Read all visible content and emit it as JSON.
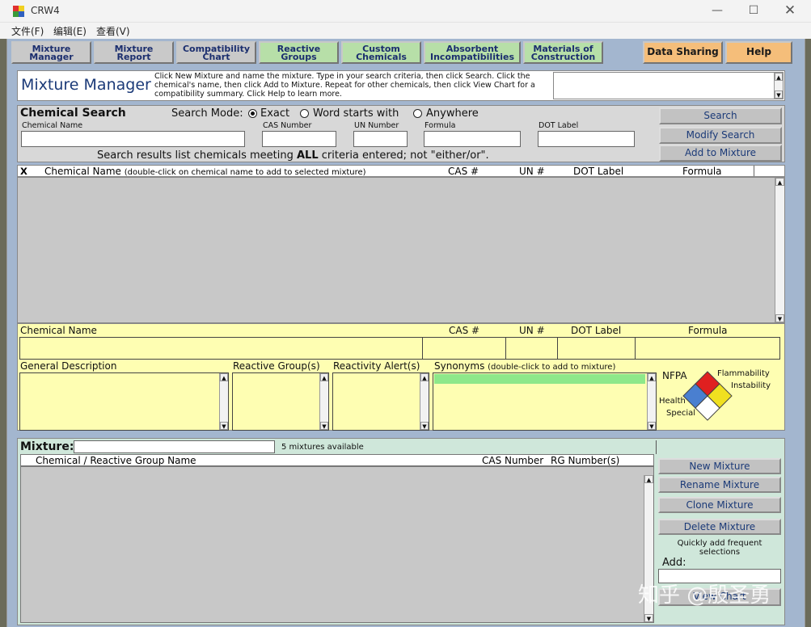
{
  "window": {
    "title": "CRW4"
  },
  "menu": [
    "文件(F)",
    "编辑(E)",
    "查看(V)"
  ],
  "tabs": [
    {
      "line1": "Mixture",
      "line2": "Manager"
    },
    {
      "line1": "Mixture",
      "line2": "Report"
    },
    {
      "line1": "Compatibility",
      "line2": "Chart"
    },
    {
      "line1": "Reactive",
      "line2": "Groups"
    },
    {
      "line1": "Custom",
      "line2": "Chemicals"
    },
    {
      "line1": "Absorbent",
      "line2": "Incompatibilities"
    },
    {
      "line1": "Materials of",
      "line2": "Construction"
    }
  ],
  "right_tabs": {
    "data_sharing": "Data Sharing",
    "help": "Help"
  },
  "header": {
    "title": "Mixture Manager",
    "instructions": "Click New Mixture and name the mixture. Type in your search criteria, then click Search. Click the chemical's name, then click Add to Mixture. Repeat for other chemicals, then click View Chart for a compatibility summary. Click Help to learn more."
  },
  "search": {
    "title": "Chemical Search",
    "mode_label": "Search Mode:",
    "modes": [
      "Exact",
      "Word starts with",
      "Anywhere"
    ],
    "selected_mode": "Exact",
    "field_labels": {
      "name": "Chemical Name",
      "cas": "CAS Number",
      "un": "UN Number",
      "formula": "Formula",
      "dot": "DOT Label"
    },
    "values": {
      "name": "",
      "cas": "",
      "un": "",
      "formula": "",
      "dot": ""
    },
    "note_before": "Search results list chemicals meeting ",
    "note_bold": "ALL",
    "note_after": " criteria entered; not \"either/or\".",
    "buttons": {
      "search": "Search",
      "modify": "Modify Search",
      "add": "Add to Mixture"
    }
  },
  "results": {
    "columns": {
      "x": "X",
      "name": "Chemical Name",
      "name_hint": "(double-click on chemical name to add to selected mixture)",
      "cas": "CAS #",
      "un": "UN #",
      "dot": "DOT Label",
      "formula": "Formula"
    },
    "rows": []
  },
  "detail": {
    "labels": {
      "name": "Chemical Name",
      "cas": "CAS #",
      "un": "UN #",
      "dot": "DOT Label",
      "formula": "Formula",
      "general": "General Description",
      "reactive": "Reactive Group(s)",
      "alerts": "Reactivity Alert(s)",
      "synonyms": "Synonyms",
      "synonyms_hint": "(double-click to add to mixture)"
    },
    "nfpa": {
      "title": "NFPA",
      "flammability": "Flammability",
      "instability": "Instability",
      "health": "Health",
      "special": "Special",
      "colors": {
        "flammability": "#e02020",
        "instability": "#f0e020",
        "health": "#4a7fd0",
        "special": "#ffffff"
      }
    }
  },
  "mixture": {
    "label": "Mixture:",
    "name_value": "",
    "available": "5 mixtures available",
    "columns": {
      "name": "Chemical / Reactive Group Name",
      "cas": "CAS Number",
      "rg": "RG Number(s)"
    },
    "buttons": {
      "new": "New Mixture",
      "rename": "Rename Mixture",
      "clone": "Clone Mixture",
      "delete": "Delete  Mixture",
      "view": "View Chart"
    },
    "quick_add": "Quickly add frequent selections",
    "add_label": "Add:"
  },
  "watermark": "知乎 @殷圣勇"
}
